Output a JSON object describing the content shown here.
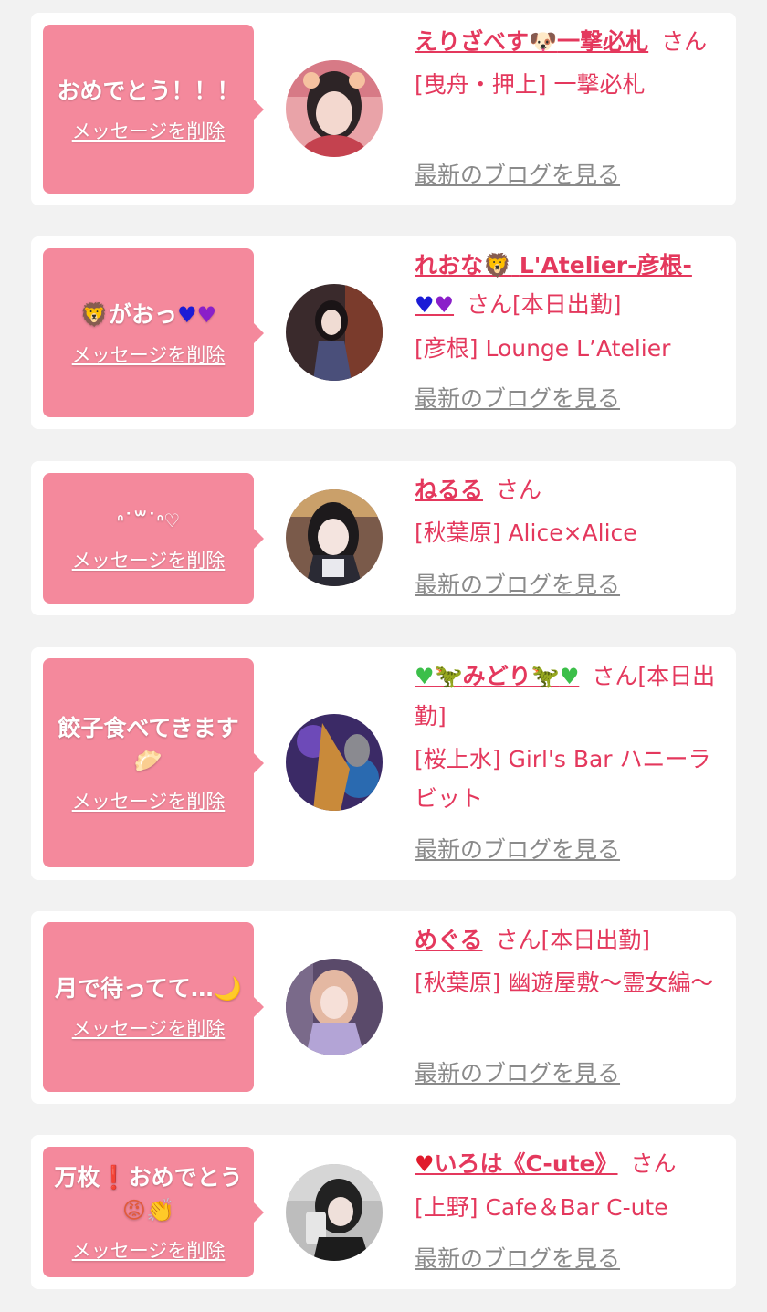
{
  "delete_label": "メッセージを削除",
  "blog_label": "最新のブログを見る",
  "san_label": "さん",
  "entries": [
    {
      "message": "おめでとう！！！",
      "name_text": "えりざべす",
      "name_suffix": "一撃必札",
      "status": "",
      "shop": "[曳舟・押上] 一撃必札"
    },
    {
      "message": "がおっ",
      "name_text": "れおな",
      "name_suffix": "L'Atelier-彦根-",
      "status": "[本日出勤]",
      "shop": "[彦根] Lounge L’Atelier"
    },
    {
      "message": "ᐢ˙꒳˙ᐢ♡",
      "name_text": "ねるる",
      "name_suffix": "",
      "status": "",
      "shop": "[秋葉原] Alice×Alice"
    },
    {
      "message": "餃子食べてきます",
      "name_text": "みどり",
      "name_suffix": "",
      "status": "[本日出勤]",
      "shop": "[桜上水] Girl's Bar ハニーラビット"
    },
    {
      "message": "月で待ってて…",
      "name_text": "めぐる",
      "name_suffix": "",
      "status": "[本日出勤]",
      "shop": "[秋葉原] 幽遊屋敷～霊女編～"
    },
    {
      "message": "万枚",
      "message_2": "おめでとう",
      "name_text": "いろは《C-ute》",
      "name_suffix": "",
      "status": "",
      "shop": "[上野] Cafe＆Bar C-ute"
    }
  ],
  "colors": {
    "accent": "#e4385d",
    "bubble": "#f4899c",
    "background": "#f2f2f2",
    "card": "#ffffff",
    "blog_link": "#8a8a8a"
  }
}
